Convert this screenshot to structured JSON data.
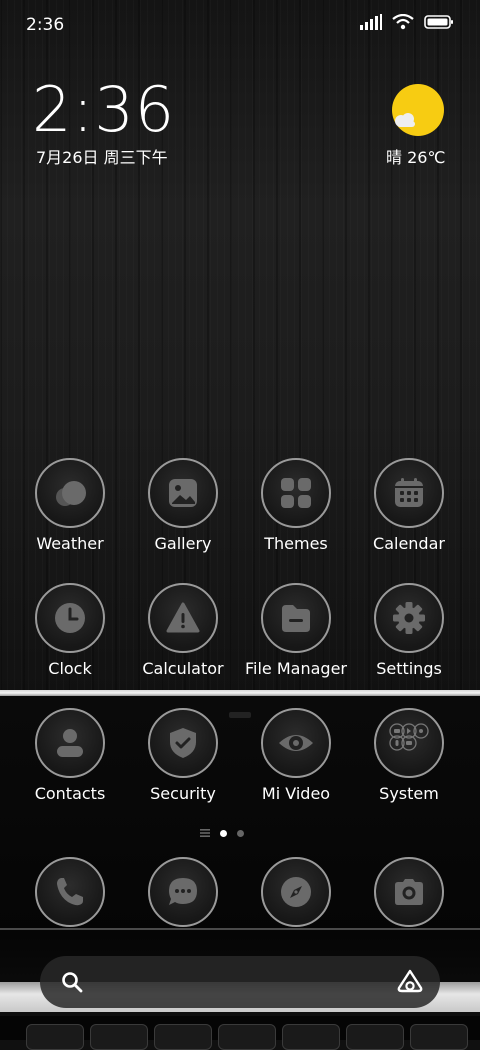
{
  "status_bar": {
    "time": "2:36"
  },
  "clock_widget": {
    "time": "2:36",
    "date": "7月26日 周三下午"
  },
  "weather_widget": {
    "condition_temp": "晴 26℃",
    "sun_color": "#f7cc12"
  },
  "apps": [
    {
      "label": "Weather",
      "icon": "weather-icon"
    },
    {
      "label": "Gallery",
      "icon": "gallery-icon"
    },
    {
      "label": "Themes",
      "icon": "themes-icon"
    },
    {
      "label": "Calendar",
      "icon": "calendar-icon"
    },
    {
      "label": "Clock",
      "icon": "clock-icon"
    },
    {
      "label": "Calculator",
      "icon": "calculator-icon"
    },
    {
      "label": "File Manager",
      "icon": "folder-icon"
    },
    {
      "label": "Settings",
      "icon": "gear-icon"
    },
    {
      "label": "Contacts",
      "icon": "contacts-icon"
    },
    {
      "label": "Security",
      "icon": "shield-icon"
    },
    {
      "label": "Mi Video",
      "icon": "eye-icon"
    },
    {
      "label": "System",
      "icon": "folder-grid-icon"
    }
  ],
  "dock": [
    {
      "icon": "phone-icon"
    },
    {
      "icon": "messages-icon"
    },
    {
      "icon": "compass-icon"
    },
    {
      "icon": "camera-icon"
    }
  ],
  "page_indicator": {
    "pages": 2,
    "current": 1
  }
}
